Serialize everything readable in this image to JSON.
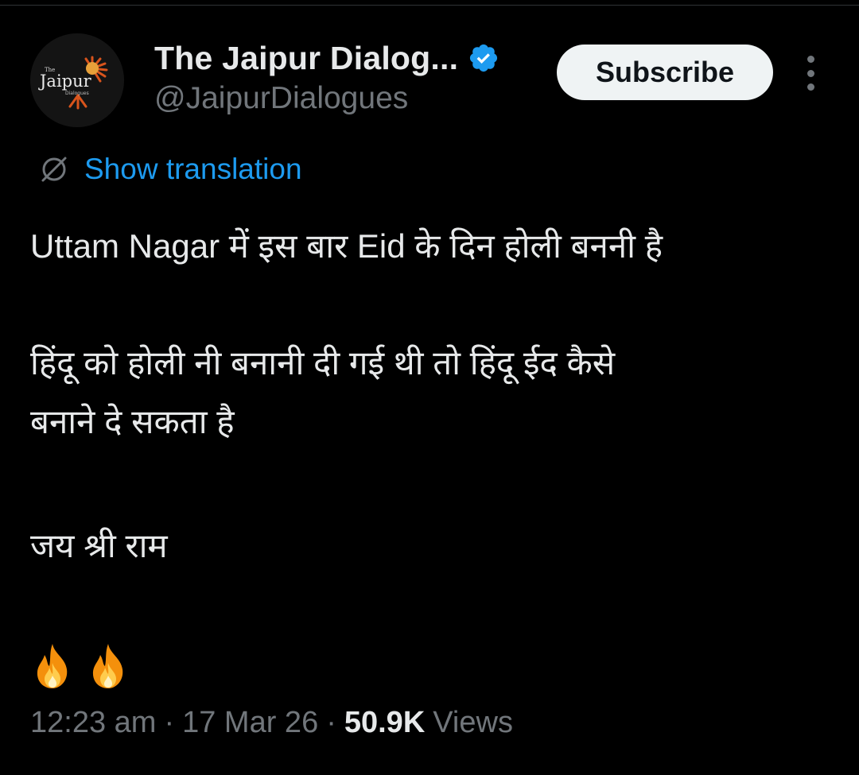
{
  "account": {
    "display_name": "The Jaipur Dialog...",
    "handle": "@JaipurDialogues",
    "avatar_logo_small": "The",
    "avatar_logo_main": "Jaipur",
    "avatar_logo_sub": "Dialogues",
    "verified": true,
    "verified_color": "#1d9bf0"
  },
  "actions": {
    "subscribe_label": "Subscribe",
    "more_icon": "more-vertical-icon"
  },
  "translation": {
    "icon": "globe-icon",
    "label": "Show translation",
    "color": "#1d9bf0"
  },
  "tweet": {
    "lines": [
      "Uttam Nagar में इस बार Eid के दिन होली बननी है",
      "हिंदू को होली नी बनानी दी गई थी तो हिंदू ईद कैसे",
      "बनाने दे सकता है",
      "जय श्री राम"
    ],
    "emojis": [
      "fire-icon",
      "fire-icon"
    ]
  },
  "meta": {
    "time": "12:23 am",
    "separator": "·",
    "date": "17 Mar 26",
    "views_count": "50.9K",
    "views_label": "Views"
  },
  "colors": {
    "background": "#000000",
    "text_primary": "#e7e9ea",
    "text_secondary": "#71767b",
    "accent": "#1d9bf0"
  }
}
